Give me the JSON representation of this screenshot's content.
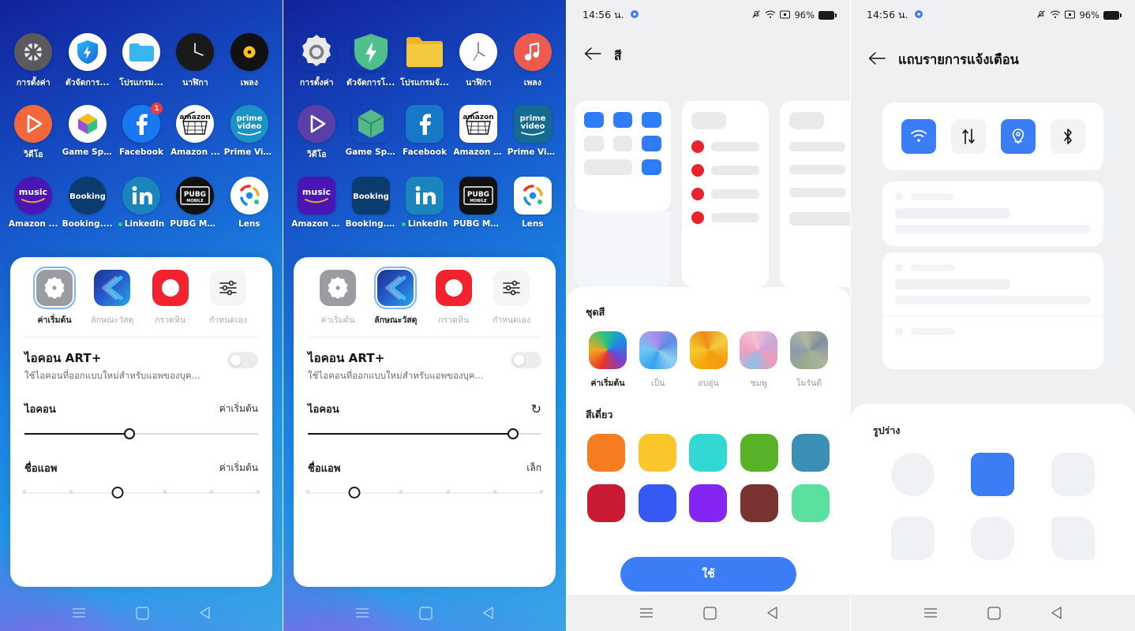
{
  "panels": {
    "p1": {
      "name": "launcher-icon-style-default",
      "apps": [
        {
          "label": "การตั้งค่า",
          "icon": "settings-gear-icon",
          "shape": "round",
          "bg": "#5a5a5e",
          "badge": null,
          "dot": false
        },
        {
          "label": "ตัวจัดการ...",
          "icon": "phone-manager-shield-icon",
          "shape": "round",
          "bg": "#ffffff",
          "badge": null,
          "dot": false
        },
        {
          "label": "โปรแกรม...",
          "icon": "file-manager-folder-icon",
          "shape": "round",
          "bg": "#ffffff",
          "badge": null,
          "dot": false
        },
        {
          "label": "นาฬิกา",
          "icon": "clock-icon",
          "shape": "round",
          "bg": "#1a1a1a",
          "badge": null,
          "dot": false
        },
        {
          "label": "เพลง",
          "icon": "music-vinyl-icon",
          "shape": "round",
          "bg": "#111111",
          "badge": null,
          "dot": false
        },
        {
          "label": "วิดีโอ",
          "icon": "video-play-icon",
          "shape": "round",
          "bg": "#f2683c",
          "badge": null,
          "dot": false
        },
        {
          "label": "Game Sp...",
          "icon": "game-space-icon",
          "shape": "round",
          "bg": "#ffffff",
          "badge": null,
          "dot": false
        },
        {
          "label": "Facebook",
          "icon": "facebook-icon",
          "shape": "round",
          "bg": "#1878f2",
          "badge": "1",
          "dot": false
        },
        {
          "label": "Amazon ...",
          "icon": "amazon-shopping-icon",
          "shape": "round",
          "bg": "#ffffff",
          "badge": null,
          "dot": false
        },
        {
          "label": "Prime Vid...",
          "icon": "prime-video-icon",
          "shape": "round",
          "bg": "#1a92c4",
          "badge": null,
          "dot": false
        },
        {
          "label": "Amazon ...",
          "icon": "amazon-music-icon",
          "shape": "round",
          "bg": "#4a15b5",
          "badge": null,
          "dot": false
        },
        {
          "label": "Booking....",
          "icon": "booking-com-icon",
          "shape": "round",
          "bg": "#0b3b6f",
          "badge": null,
          "dot": false
        },
        {
          "label": "LinkedIn",
          "icon": "linkedin-icon",
          "shape": "round",
          "bg": "#1a85bc",
          "badge": null,
          "dot": true
        },
        {
          "label": "PUBG MO...",
          "icon": "pubg-mobile-icon",
          "shape": "round",
          "bg": "#111111",
          "badge": null,
          "dot": false
        },
        {
          "label": "Lens",
          "icon": "google-lens-icon",
          "shape": "round",
          "bg": "#ffffff",
          "badge": null,
          "dot": false
        }
      ],
      "sheet": {
        "tabs": [
          {
            "label": "ค่าเริ่มต้น",
            "icon": "default-style-icon",
            "selected": true
          },
          {
            "label": "ลักษณะวัสดุ",
            "icon": "material-style-icon",
            "selected": false
          },
          {
            "label": "กรวดหิน",
            "icon": "pebble-style-icon",
            "selected": false
          },
          {
            "label": "กำหนดเอง",
            "icon": "custom-sliders-icon",
            "selected": false
          }
        ],
        "art_plus": {
          "title": "ไอคอน ART+",
          "subtitle": "ใช้ไอคอนที่ออกแบบใหม่สำหรับแอพของบุค...",
          "toggle_on": false
        },
        "icon_slider": {
          "label": "ไอคอน",
          "value_label": "ค่าเริ่มต้น",
          "percent": 45,
          "has_reset": false
        },
        "appname_slider": {
          "label": "ชื่อแอพ",
          "value_label": "ค่าเริ่มต้น",
          "percent": 40,
          "steps": 6
        }
      }
    },
    "p2": {
      "name": "launcher-icon-style-material",
      "apps": [
        {
          "label": "การตั้งค่า",
          "icon": "settings-gear-icon",
          "shape": "flower",
          "bg": "#e9eaec",
          "badge": null,
          "dot": false
        },
        {
          "label": "ตัวจัดการโ...",
          "icon": "phone-manager-shield-icon",
          "shape": "shield",
          "bg": "#43b581",
          "badge": null,
          "dot": false
        },
        {
          "label": "โปรแกรมจั...",
          "icon": "file-manager-folder-icon",
          "shape": "folder",
          "bg": "#f0bb2c",
          "badge": null,
          "dot": false
        },
        {
          "label": "นาฬิกา",
          "icon": "clock-icon",
          "shape": "round",
          "bg": "#ffffff",
          "badge": null,
          "dot": false
        },
        {
          "label": "เพลง",
          "icon": "music-note-icon",
          "shape": "round",
          "bg": "#ef5a4e",
          "badge": null,
          "dot": false
        },
        {
          "label": "วิดีโอ",
          "icon": "video-play-icon",
          "shape": "round",
          "bg": "#5b3fa8",
          "badge": null,
          "dot": false
        },
        {
          "label": "Game Space",
          "icon": "game-space-icon",
          "shape": "hex",
          "bg": "#4aab7e",
          "badge": null,
          "dot": false
        },
        {
          "label": "Facebook",
          "icon": "facebook-icon",
          "shape": "square",
          "bg": "#1878c8",
          "badge": null,
          "dot": false
        },
        {
          "label": "Amazon S...",
          "icon": "amazon-shopping-icon",
          "shape": "square",
          "bg": "#ffffff",
          "badge": null,
          "dot": false
        },
        {
          "label": "Prime Video",
          "icon": "prime-video-icon",
          "shape": "square",
          "bg": "#146a90",
          "badge": null,
          "dot": false
        },
        {
          "label": "Amazon M...",
          "icon": "amazon-music-icon",
          "shape": "square",
          "bg": "#4a15b5",
          "badge": null,
          "dot": false
        },
        {
          "label": "Booking.c...",
          "icon": "booking-com-icon",
          "shape": "square",
          "bg": "#0b3b6f",
          "badge": null,
          "dot": false
        },
        {
          "label": "LinkedIn",
          "icon": "linkedin-icon",
          "shape": "square",
          "bg": "#1a85bc",
          "badge": null,
          "dot": true
        },
        {
          "label": "PUBG MO...",
          "icon": "pubg-mobile-icon",
          "shape": "square",
          "bg": "#111111",
          "badge": null,
          "dot": false
        },
        {
          "label": "Lens",
          "icon": "google-lens-icon",
          "shape": "square",
          "bg": "#ffffff",
          "badge": null,
          "dot": false
        }
      ],
      "sheet": {
        "tabs": [
          {
            "label": "ค่าเริ่มต้น",
            "icon": "default-style-icon",
            "selected": false
          },
          {
            "label": "ลักษณะวัสดุ",
            "icon": "material-style-icon",
            "selected": true
          },
          {
            "label": "กรวดหิน",
            "icon": "pebble-style-icon",
            "selected": false
          },
          {
            "label": "กำหนดเอง",
            "icon": "custom-sliders-icon",
            "selected": false
          }
        ],
        "art_plus": {
          "title": "ไอคอน ART+",
          "subtitle": "ใช้ไอคอนที่ออกแบบใหม่สำหรับแอพของบุค...",
          "toggle_on": false
        },
        "icon_slider": {
          "label": "ไอคอน",
          "value_label": "",
          "percent": 88,
          "has_reset": true,
          "reset_icon": "reset-icon"
        },
        "appname_slider": {
          "label": "ชื่อแอพ",
          "value_label": "เล็ก",
          "percent": 20,
          "steps": 6
        }
      }
    },
    "p3": {
      "name": "color-settings-screen",
      "status": {
        "time": "14:56 น.",
        "gear_icon": "gear-icon",
        "alarm_icon": "alarm-off-icon",
        "wifi_icon": "wifi-icon",
        "sim_icon": "sim-icon",
        "battery": "96%"
      },
      "header": {
        "back_icon": "back-arrow-icon",
        "title": "สี"
      },
      "preview": {
        "card1_icon": "grid-preview-card",
        "card2_icon": "list-preview-card",
        "card3_icon": "list-preview-card"
      },
      "theme_section": {
        "title": "ชุดสี",
        "items": [
          {
            "label": "ค่าเริ่มต้น",
            "selected": true,
            "colors": [
              "#e8342a",
              "#f0a91e",
              "#2fc47a",
              "#1b8ce8",
              "#7b3fd0"
            ]
          },
          {
            "label": "เป็น",
            "selected": false,
            "colors": [
              "#3aa0ef",
              "#6fc9f5",
              "#b08ce8",
              "#5a8ae8",
              "#8fd4f0"
            ]
          },
          {
            "label": "อบอุ่น",
            "selected": false,
            "colors": [
              "#f5a60c",
              "#f7c92e",
              "#ef8a18",
              "#f0d040",
              "#f59b10"
            ]
          },
          {
            "label": "ชมพู",
            "selected": false,
            "colors": [
              "#8fbfe8",
              "#f0a0c0",
              "#f5c0d0",
              "#c9a8dd",
              "#f09cb8"
            ]
          },
          {
            "label": "โมรันดี",
            "selected": false,
            "colors": [
              "#9aab8a",
              "#8d9bb0",
              "#b0b89a",
              "#7e8fa0",
              "#a8b49c"
            ]
          }
        ]
      },
      "single_color_section": {
        "title": "สีเดี่ยว",
        "colors": [
          "#f57c20",
          "#fbc52c",
          "#34d8d2",
          "#58b227",
          "#3b8fb5",
          "#c81a33",
          "#3559f2",
          "#8425f5",
          "#7a3330",
          "#5ce0a0"
        ]
      },
      "apply_button": "ใช้"
    },
    "p4": {
      "name": "notification-shade-settings-screen",
      "status": {
        "time": "14:56 น.",
        "gear_icon": "gear-icon",
        "alarm_icon": "alarm-off-icon",
        "wifi_icon": "wifi-icon",
        "sim_icon": "sim-icon",
        "battery": "96%"
      },
      "header": {
        "back_icon": "back-arrow-icon",
        "title": "แถบรายการแจ้งเตือน"
      },
      "quick_tiles": [
        {
          "icon": "wifi-icon",
          "on": true
        },
        {
          "icon": "mobile-data-icon",
          "on": false
        },
        {
          "icon": "location-icon",
          "on": true
        },
        {
          "icon": "bluetooth-icon",
          "on": false
        }
      ],
      "shape_section": {
        "title": "รูปร่าง",
        "shapes": [
          {
            "name": "circle",
            "selected": false,
            "radius": "50%"
          },
          {
            "name": "rounded-square",
            "selected": true,
            "radius": "11px"
          },
          {
            "name": "squircle",
            "selected": false,
            "radius": "17px"
          },
          {
            "name": "teardrop",
            "selected": false,
            "radius": "17px 17px 17px 6px"
          },
          {
            "name": "soft-squircle",
            "selected": false,
            "radius": "22px"
          },
          {
            "name": "leaf",
            "selected": false,
            "radius": "6px 20px 6px 20px"
          }
        ]
      }
    }
  },
  "navbar": {
    "menu_icon": "menu-icon",
    "home_icon": "home-square-icon",
    "back_icon": "back-triangle-icon"
  }
}
